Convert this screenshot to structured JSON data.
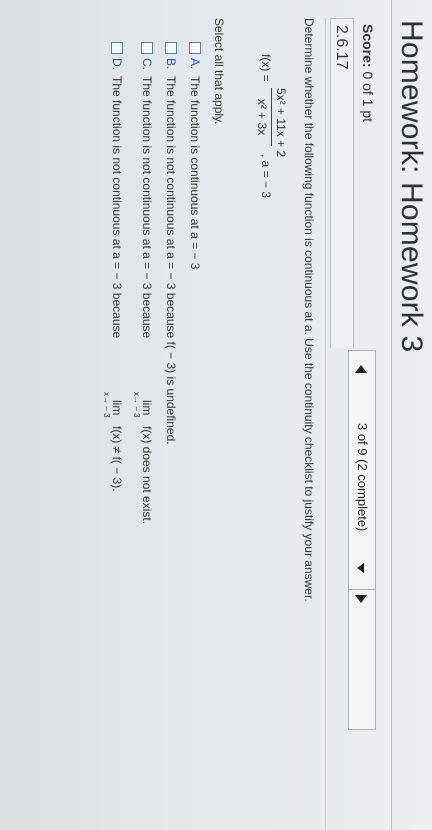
{
  "header": {
    "title": "Homework: Homework 3"
  },
  "score": {
    "label": "Score:",
    "value": "0 of 1 pt"
  },
  "question": {
    "id": "2.6.17"
  },
  "nav": {
    "progress": "3 of 9 (2 complete)"
  },
  "problem": {
    "instruction": "Determine whether the following function is continuous at a. Use the continuity checklist to justify your answer.",
    "function": {
      "lhs": "f(x) =",
      "numerator": "5x² + 11x + 2",
      "denominator": "x² + 3x",
      "point": ", a = − 3"
    },
    "select_all": "Select all that apply."
  },
  "options": [
    {
      "letter": "A.",
      "text": "The function is continuous at a = − 3"
    },
    {
      "letter": "B.",
      "text": "The function is not continuous at a = − 3 because f( − 3) is undefined."
    },
    {
      "letter": "C.",
      "text_before": "The function is not continuous at a = − 3 because",
      "lim": "lim",
      "lim_sub": "x→ − 3",
      "text_after": "f(x) does not exist."
    },
    {
      "letter": "D.",
      "text_before": "The function is not continuous at a = − 3 because",
      "lim": "lim",
      "lim_sub": "x→ − 3",
      "text_after": "f(x) ≠ f( − 3)."
    }
  ]
}
